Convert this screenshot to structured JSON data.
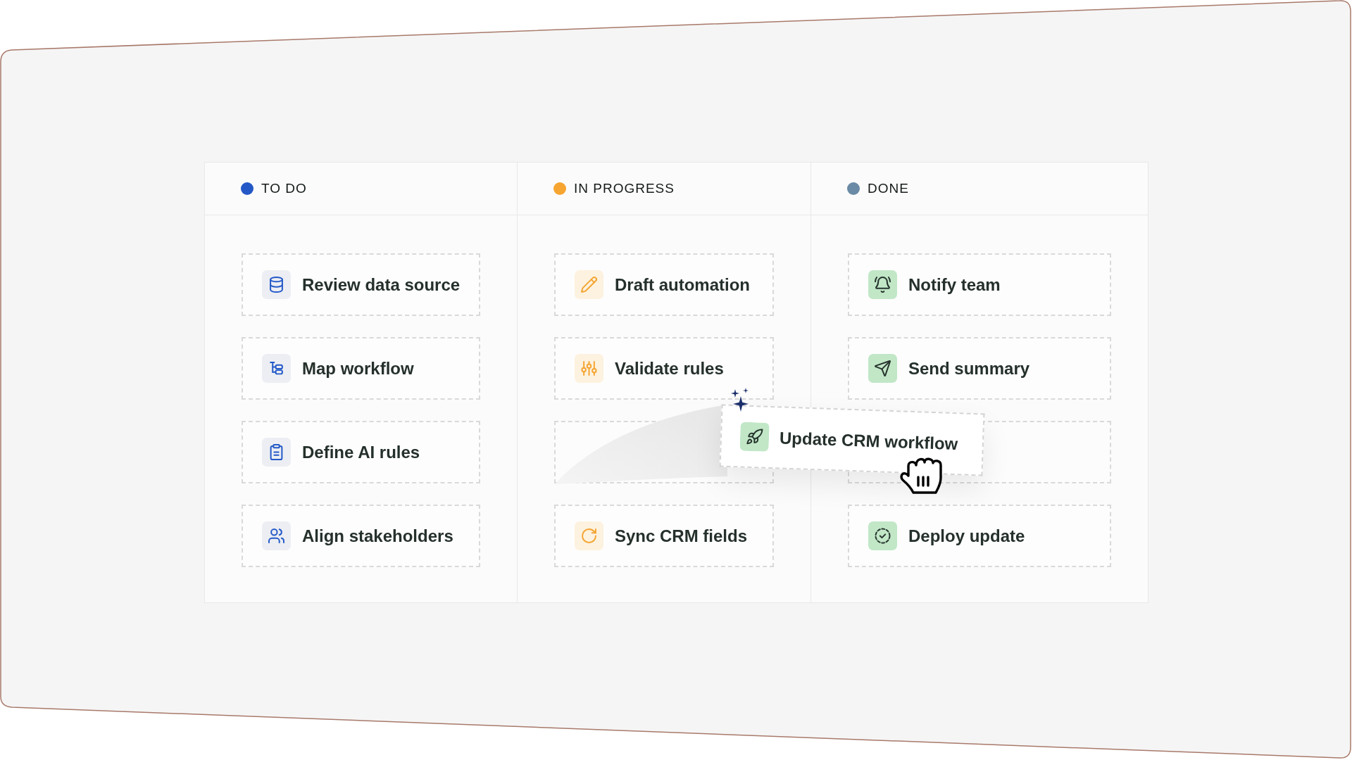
{
  "board": {
    "columns": [
      {
        "title": "TO DO",
        "kind": "todo",
        "color": "#2458c6",
        "cards": [
          {
            "kind": "task",
            "title": "Review data source"
          },
          {
            "kind": "task",
            "title": "Map workflow"
          },
          {
            "kind": "task",
            "title": "Define AI rules"
          },
          {
            "kind": "task",
            "title": "Align stakeholders"
          }
        ]
      },
      {
        "title": "IN PROGRESS",
        "kind": "progress",
        "color": "#f7a531",
        "cards": [
          {
            "kind": "task",
            "title": "Draft automation"
          },
          {
            "kind": "task",
            "title": "Validate rules"
          },
          {
            "kind": "empty"
          },
          {
            "kind": "task",
            "title": "Sync CRM fields"
          }
        ]
      },
      {
        "title": "DONE",
        "kind": "done",
        "color": "#6a8aa5",
        "cards": [
          {
            "kind": "task",
            "title": "Notify team"
          },
          {
            "kind": "task",
            "title": "Send summary"
          },
          {
            "kind": "empty"
          },
          {
            "kind": "task",
            "title": "Deploy update"
          }
        ]
      }
    ],
    "dragged_card": {
      "title": "Update CRM workflow"
    }
  }
}
